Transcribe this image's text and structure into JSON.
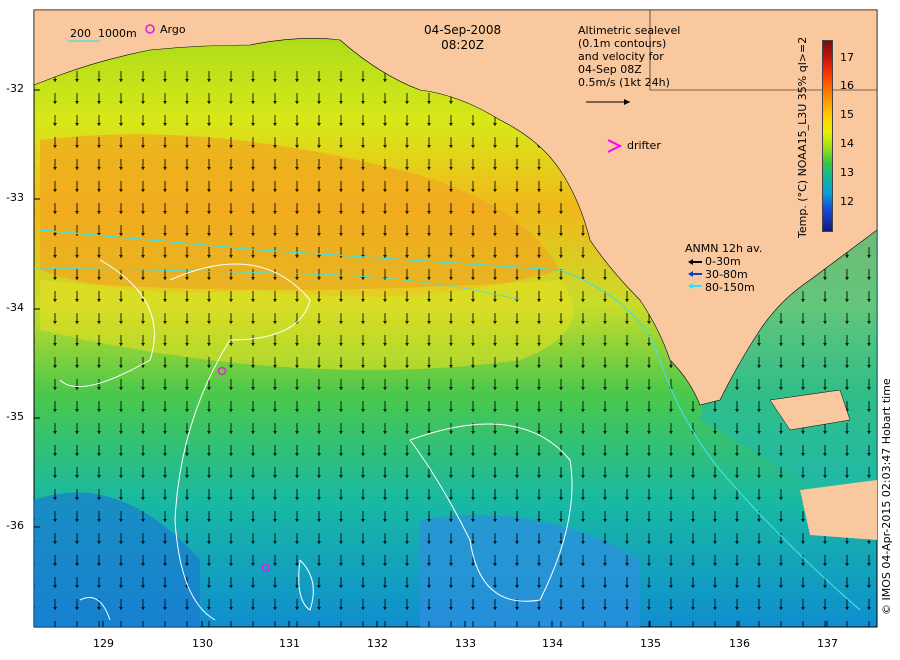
{
  "header": {
    "date": "04-Sep-2008",
    "time": "08:20Z"
  },
  "depth_legend": {
    "label_200": "200",
    "label_1000": "1000m"
  },
  "argo_legend": {
    "label": "Argo"
  },
  "altimetry_legend": {
    "line1": "Altimetric sealevel",
    "line2": "(0.1m contours)",
    "line3": "and velocity for",
    "line4": "04-Sep 08Z",
    "line5": "0.5m/s (1kt 24h)"
  },
  "drifter_legend": {
    "symbol": ">",
    "label": "drifter"
  },
  "anmn_legend": {
    "title": "ANMN 12h av.",
    "items": [
      {
        "label": "0-30m",
        "color": "#000000"
      },
      {
        "label": "30-80m",
        "color": "#1040c0"
      },
      {
        "label": "80-150m",
        "color": "#30e0ff"
      }
    ]
  },
  "colorbar": {
    "ticks": [
      "17",
      "16",
      "15",
      "14",
      "13",
      "12"
    ],
    "title": "Temp. (°C) NOAA15_L3U 35% ql>=2"
  },
  "axes": {
    "y_ticks": [
      "-32",
      "-33",
      "-34",
      "-35",
      "-36"
    ],
    "x_ticks": [
      "129",
      "130",
      "131",
      "132",
      "133",
      "134",
      "135",
      "136",
      "137"
    ]
  },
  "credit": "© IMOS 04-Apr-2015 02:03:47 Hobart time",
  "colors": {
    "land": "#f9c89e",
    "argo": "#e020e0",
    "drifter": "#ff00ff",
    "contour_white": "#ffffff",
    "shelf_line": "#40e0e0"
  }
}
